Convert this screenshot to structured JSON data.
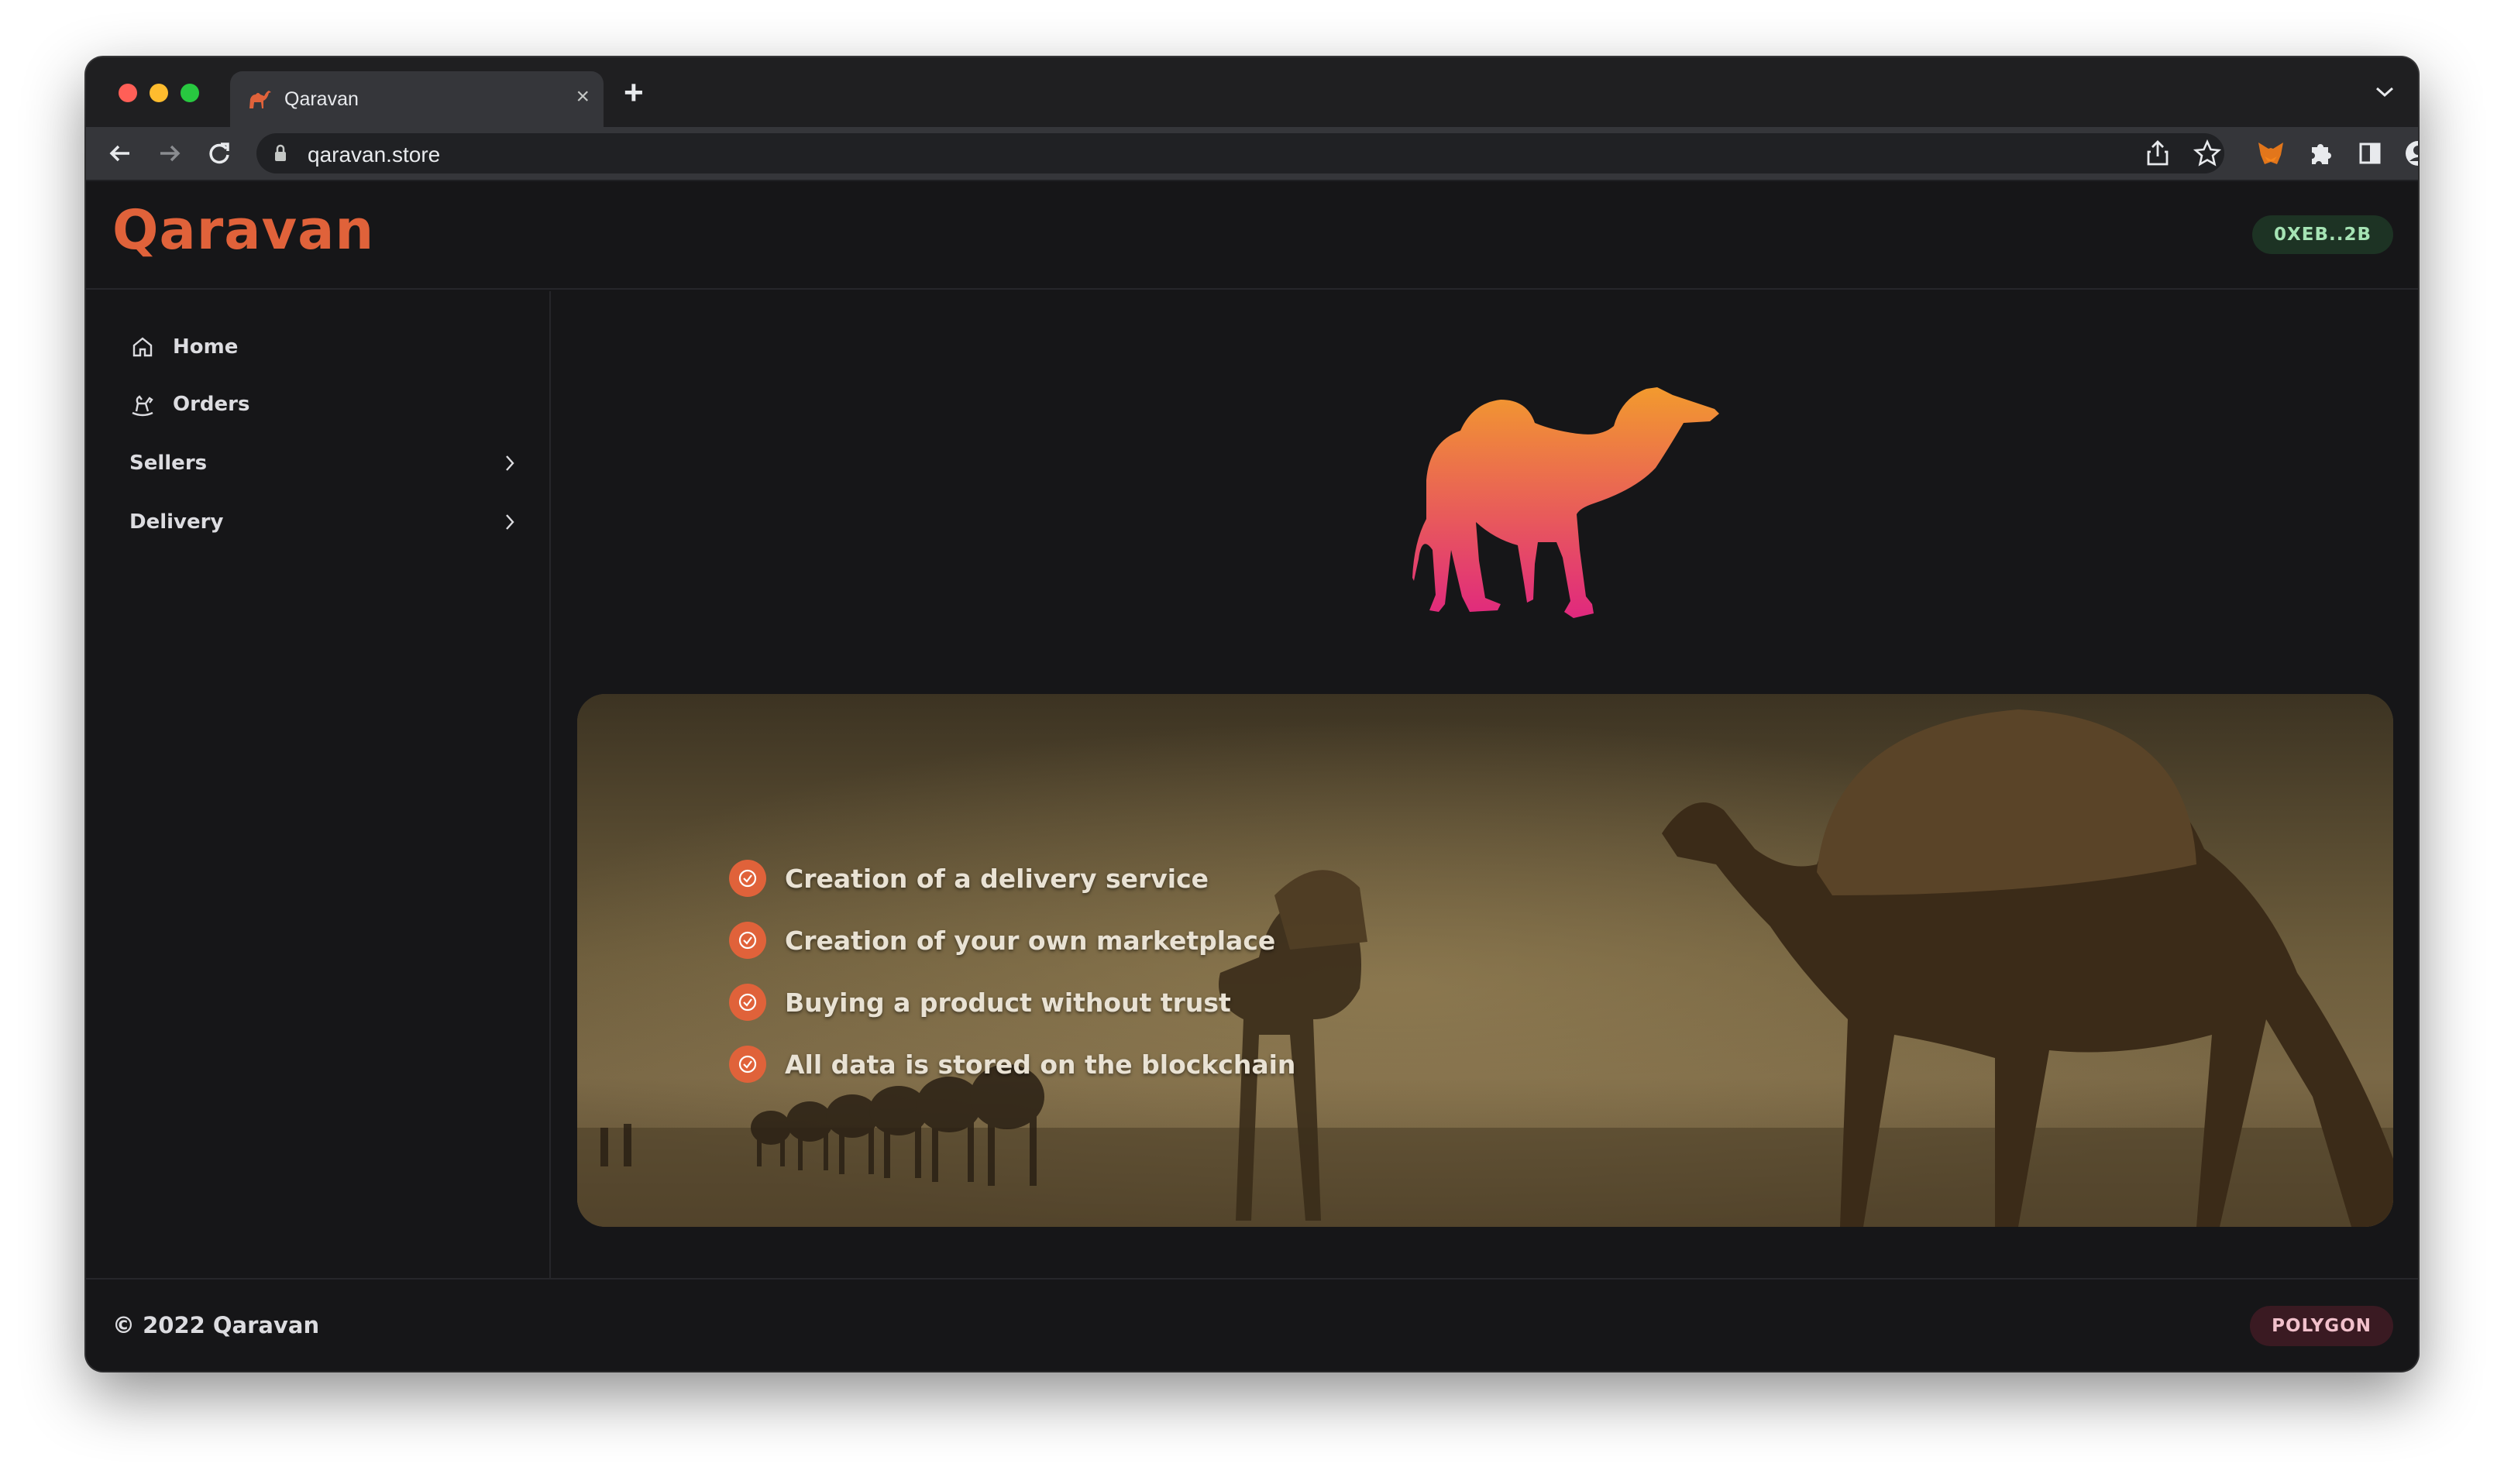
{
  "browser": {
    "tab_title": "Qaravan",
    "tab_close": "×",
    "new_tab": "+",
    "url": "qaravan.store"
  },
  "app": {
    "logo": "Qaravan",
    "wallet_address": "0XEB..2B",
    "network": "POLYGON",
    "copyright": "© 2022 Qaravan"
  },
  "sidebar": {
    "items": [
      {
        "label": "Home",
        "icon": "home-icon",
        "expandable": false
      },
      {
        "label": "Orders",
        "icon": "rocking-horse-icon",
        "expandable": false
      },
      {
        "label": "Sellers",
        "icon": "",
        "expandable": true
      },
      {
        "label": "Delivery",
        "icon": "",
        "expandable": true
      }
    ]
  },
  "features": [
    "Creation of a delivery service",
    "Creation of your own marketplace",
    "Buying a product without trust",
    "All data is stored on the blockchain"
  ],
  "colors": {
    "brand": "#e0623a",
    "logo_gradient_top": "#f29a2e",
    "logo_gradient_bottom": "#e0287e",
    "wallet_badge_bg": "#1d3324",
    "network_badge_bg": "#3a1a22"
  }
}
